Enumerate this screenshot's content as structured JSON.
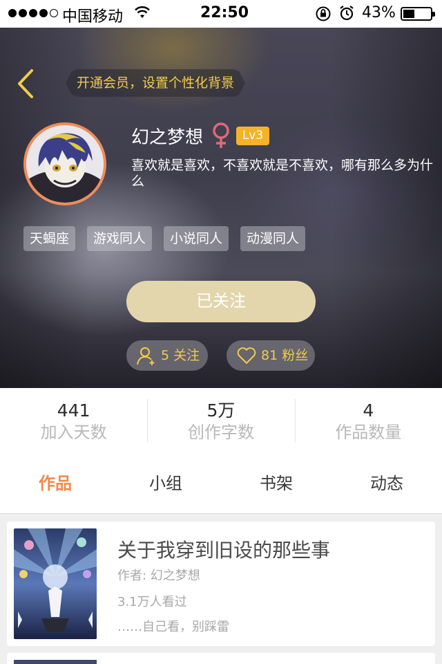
{
  "status_bar": {
    "carrier": "中国移动",
    "time": "22:50",
    "battery_percent": "43%",
    "battery_level": 0.43
  },
  "header": {
    "vip_banner": "开通会员，设置个性化背景"
  },
  "profile": {
    "nickname": "幻之梦想",
    "level": "Lv3",
    "gender_icon": "female-icon",
    "bio": "喜欢就是喜欢，不喜欢就是不喜欢，哪有那么多为什么",
    "tags": [
      "天蝎座",
      "游戏同人",
      "小说同人",
      "动漫同人"
    ],
    "follow_button": "已关注",
    "following_label": "5 关注",
    "fans_label": "81 粉丝"
  },
  "colors": {
    "accent_orange": "#f0884a",
    "gold_text": "#f2cc4a",
    "level_badge": "#f5b327",
    "follow_button_bg": "#e3d6ad"
  },
  "stats": [
    {
      "value": "441",
      "label": "加入天数"
    },
    {
      "value": "5万",
      "label": "创作字数"
    },
    {
      "value": "4",
      "label": "作品数量"
    }
  ],
  "tabs": [
    {
      "label": "作品",
      "active": true
    },
    {
      "label": "小组",
      "active": false
    },
    {
      "label": "书架",
      "active": false
    },
    {
      "label": "动态",
      "active": false
    }
  ],
  "works": [
    {
      "title": "关于我穿到旧设的那些事",
      "author": "作者: 幻之梦想",
      "views": "3.1万人看过",
      "desc": "……自己看，别踩雷"
    }
  ]
}
